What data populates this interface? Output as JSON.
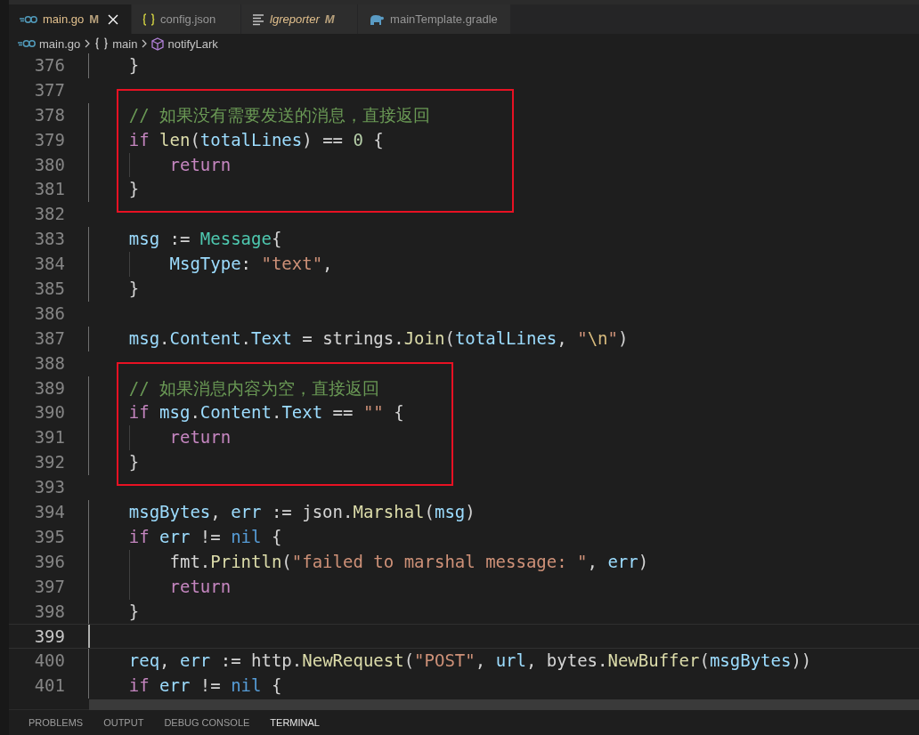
{
  "tabs": [
    {
      "kind": "go",
      "label": "main.go",
      "status": "M",
      "selected": true,
      "italic": false,
      "closable": true
    },
    {
      "kind": "json",
      "label": "config.json",
      "selected": false,
      "italic": false,
      "closable": false
    },
    {
      "kind": "file",
      "label": "lgreporter",
      "status": "M",
      "selected": false,
      "italic": true,
      "closable": false
    },
    {
      "kind": "gradle",
      "label": "mainTemplate.gradle",
      "selected": false,
      "italic": false,
      "closable": false
    }
  ],
  "breadcrumb": [
    {
      "kind": "go",
      "label": "main.go"
    },
    {
      "kind": "braces",
      "label": "main"
    },
    {
      "kind": "cube",
      "label": "notifyLark"
    }
  ],
  "code": [
    {
      "kind": "plain",
      "lines": [
        {
          "number": "376",
          "current": false,
          "tokens": [
            {
              "kind": "plain",
              "text": "    }"
            }
          ]
        },
        {
          "number": "377",
          "current": false
        }
      ]
    },
    {
      "kind": "boxed",
      "lines": [
        {
          "number": "378",
          "current": false,
          "tokens": [
            {
              "kind": "cmt",
              "text": "    // 如果没有需要发送的消息，直接返回"
            }
          ]
        },
        {
          "number": "379",
          "current": false,
          "tokens": [
            {
              "kind": "kw",
              "text": "    if "
            },
            {
              "kind": "fn",
              "text": "len"
            },
            {
              "kind": "plain",
              "text": "("
            },
            {
              "kind": "var",
              "text": "totalLines"
            },
            {
              "kind": "plain",
              "text": ") == "
            },
            {
              "kind": "num",
              "text": "0"
            },
            {
              "kind": "plain",
              "text": " {"
            }
          ]
        },
        {
          "number": "380",
          "current": false,
          "tokens": [
            {
              "kind": "kw",
              "text": "        return"
            }
          ]
        },
        {
          "number": "381",
          "current": false,
          "tokens": [
            {
              "kind": "plain",
              "text": "    }"
            }
          ]
        }
      ]
    },
    {
      "kind": "plain",
      "lines": [
        {
          "number": "382",
          "current": false
        },
        {
          "number": "383",
          "current": false,
          "tokens": [
            {
              "kind": "var",
              "text": "    msg"
            },
            {
              "kind": "plain",
              "text": " := "
            },
            {
              "kind": "type",
              "text": "Message"
            },
            {
              "kind": "plain",
              "text": "{"
            }
          ]
        },
        {
          "number": "384",
          "current": false,
          "tokens": [
            {
              "kind": "var",
              "text": "        MsgType"
            },
            {
              "kind": "plain",
              "text": ": "
            },
            {
              "kind": "str",
              "text": "\"text\""
            },
            {
              "kind": "plain",
              "text": ","
            }
          ]
        },
        {
          "number": "385",
          "current": false,
          "tokens": [
            {
              "kind": "plain",
              "text": "    }"
            }
          ]
        },
        {
          "number": "386",
          "current": false
        },
        {
          "number": "387",
          "current": false,
          "tokens": [
            {
              "kind": "var",
              "text": "    msg"
            },
            {
              "kind": "plain",
              "text": "."
            },
            {
              "kind": "var",
              "text": "Content"
            },
            {
              "kind": "plain",
              "text": "."
            },
            {
              "kind": "var",
              "text": "Text"
            },
            {
              "kind": "plain",
              "text": " = strings."
            },
            {
              "kind": "fn",
              "text": "Join"
            },
            {
              "kind": "plain",
              "text": "("
            },
            {
              "kind": "var",
              "text": "totalLines"
            },
            {
              "kind": "plain",
              "text": ", "
            },
            {
              "kind": "str",
              "text": "\""
            },
            {
              "kind": "esc",
              "text": "\\n"
            },
            {
              "kind": "str",
              "text": "\""
            },
            {
              "kind": "plain",
              "text": ")"
            }
          ]
        },
        {
          "number": "388",
          "current": false
        }
      ]
    },
    {
      "kind": "boxed",
      "lines": [
        {
          "number": "389",
          "current": false,
          "tokens": [
            {
              "kind": "cmt",
              "text": "    // 如果消息内容为空，直接返回"
            }
          ]
        },
        {
          "number": "390",
          "current": false,
          "tokens": [
            {
              "kind": "kw",
              "text": "    if "
            },
            {
              "kind": "var",
              "text": "msg"
            },
            {
              "kind": "plain",
              "text": "."
            },
            {
              "kind": "var",
              "text": "Content"
            },
            {
              "kind": "plain",
              "text": "."
            },
            {
              "kind": "var",
              "text": "Text"
            },
            {
              "kind": "plain",
              "text": " == "
            },
            {
              "kind": "str",
              "text": "\"\""
            },
            {
              "kind": "plain",
              "text": " {"
            }
          ]
        },
        {
          "number": "391",
          "current": false,
          "tokens": [
            {
              "kind": "kw",
              "text": "        return"
            }
          ]
        },
        {
          "number": "392",
          "current": false,
          "tokens": [
            {
              "kind": "plain",
              "text": "    }"
            }
          ]
        }
      ]
    },
    {
      "kind": "plain",
      "lines": [
        {
          "number": "393",
          "current": false
        },
        {
          "number": "394",
          "current": false,
          "tokens": [
            {
              "kind": "var",
              "text": "    msgBytes"
            },
            {
              "kind": "plain",
              "text": ", "
            },
            {
              "kind": "var",
              "text": "err"
            },
            {
              "kind": "plain",
              "text": " := json."
            },
            {
              "kind": "fn",
              "text": "Marshal"
            },
            {
              "kind": "plain",
              "text": "("
            },
            {
              "kind": "var",
              "text": "msg"
            },
            {
              "kind": "plain",
              "text": ")"
            }
          ]
        },
        {
          "number": "395",
          "current": false,
          "tokens": [
            {
              "kind": "kw",
              "text": "    if "
            },
            {
              "kind": "var",
              "text": "err"
            },
            {
              "kind": "plain",
              "text": " != "
            },
            {
              "kind": "const",
              "text": "nil"
            },
            {
              "kind": "plain",
              "text": " {"
            }
          ]
        },
        {
          "number": "396",
          "current": false,
          "tokens": [
            {
              "kind": "plain",
              "text": "        fmt."
            },
            {
              "kind": "fn",
              "text": "Println"
            },
            {
              "kind": "plain",
              "text": "("
            },
            {
              "kind": "str",
              "text": "\"failed to marshal message: \""
            },
            {
              "kind": "plain",
              "text": ", "
            },
            {
              "kind": "var",
              "text": "err"
            },
            {
              "kind": "plain",
              "text": ")"
            }
          ]
        },
        {
          "number": "397",
          "current": false,
          "tokens": [
            {
              "kind": "kw",
              "text": "        return"
            }
          ]
        },
        {
          "number": "398",
          "current": false,
          "tokens": [
            {
              "kind": "plain",
              "text": "    }"
            }
          ]
        },
        {
          "number": "399",
          "current": true
        },
        {
          "number": "400",
          "current": false,
          "tokens": [
            {
              "kind": "var",
              "text": "    req"
            },
            {
              "kind": "plain",
              "text": ", "
            },
            {
              "kind": "var",
              "text": "err"
            },
            {
              "kind": "plain",
              "text": " := http."
            },
            {
              "kind": "fn",
              "text": "NewRequest"
            },
            {
              "kind": "plain",
              "text": "("
            },
            {
              "kind": "str",
              "text": "\"POST\""
            },
            {
              "kind": "plain",
              "text": ", "
            },
            {
              "kind": "var",
              "text": "url"
            },
            {
              "kind": "plain",
              "text": ", bytes."
            },
            {
              "kind": "fn",
              "text": "NewBuffer"
            },
            {
              "kind": "plain",
              "text": "("
            },
            {
              "kind": "var",
              "text": "msgBytes"
            },
            {
              "kind": "plain",
              "text": "))"
            }
          ]
        },
        {
          "number": "401",
          "current": false,
          "tokens": [
            {
              "kind": "kw",
              "text": "    if "
            },
            {
              "kind": "var",
              "text": "err"
            },
            {
              "kind": "plain",
              "text": " != "
            },
            {
              "kind": "const",
              "text": "nil"
            },
            {
              "kind": "plain",
              "text": " {"
            }
          ]
        }
      ]
    }
  ],
  "panel_tabs": [
    {
      "label": "PROBLEMS",
      "selected": false
    },
    {
      "label": "OUTPUT",
      "selected": false
    },
    {
      "label": "DEBUG CONSOLE",
      "selected": false
    },
    {
      "label": "TERMINAL",
      "selected": true
    }
  ]
}
